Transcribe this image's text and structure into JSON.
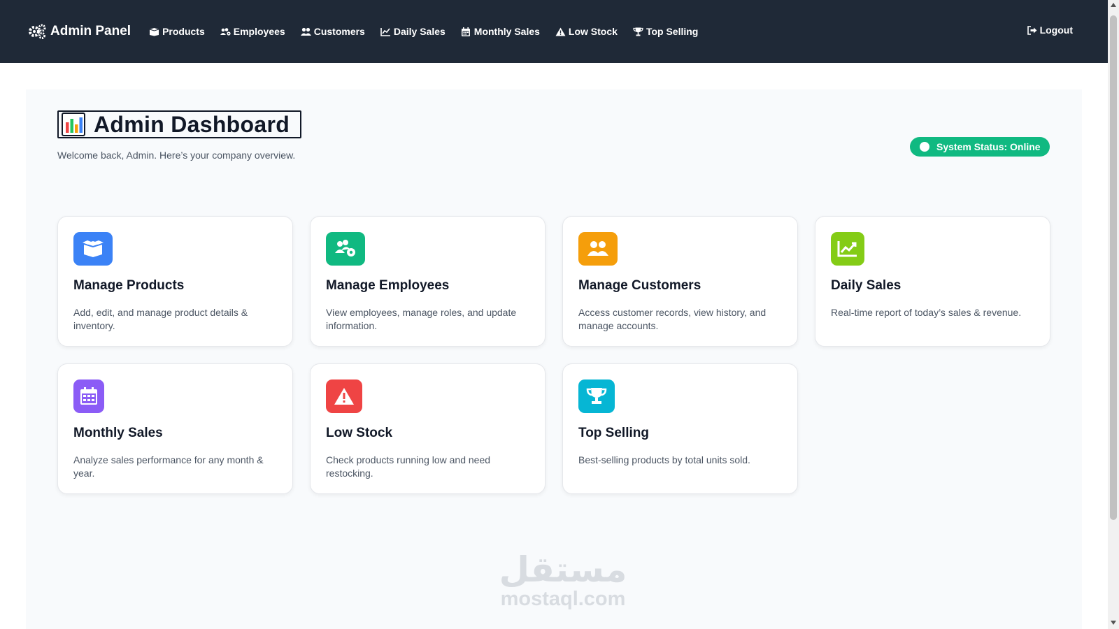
{
  "navbar": {
    "brand": "Admin Panel",
    "links": [
      {
        "label": "Products",
        "icon": "box-icon"
      },
      {
        "label": "Employees",
        "icon": "users-gear-icon"
      },
      {
        "label": "Customers",
        "icon": "users-icon"
      },
      {
        "label": "Daily Sales",
        "icon": "chart-line-icon"
      },
      {
        "label": "Monthly Sales",
        "icon": "calendar-icon"
      },
      {
        "label": "Low Stock",
        "icon": "warning-icon"
      },
      {
        "label": "Top Selling",
        "icon": "trophy-icon"
      }
    ],
    "logout": "Logout"
  },
  "header": {
    "title": "Admin Dashboard",
    "subtitle": "Welcome back, Admin. Here’s your company overview.",
    "status": "System Status: Online"
  },
  "cards": [
    {
      "title": "Manage Products",
      "desc": "Add, edit, and manage product details & inventory.",
      "icon": "box-open-icon",
      "color": "#3b82f6"
    },
    {
      "title": "Manage Employees",
      "desc": "View employees, manage roles, and update information.",
      "icon": "users-gear-icon",
      "color": "#10b981"
    },
    {
      "title": "Manage Customers",
      "desc": "Access customer records, view history, and manage accounts.",
      "icon": "users-icon",
      "color": "#f59e0b"
    },
    {
      "title": "Daily Sales",
      "desc": "Real-time report of today’s sales & revenue.",
      "icon": "chart-line-icon",
      "color": "#84cc16"
    },
    {
      "title": "Monthly Sales",
      "desc": "Analyze sales performance for any month & year.",
      "icon": "calendar-icon",
      "color": "#8b5cf6"
    },
    {
      "title": "Low Stock",
      "desc": "Check products running low and need restocking.",
      "icon": "warning-icon",
      "color": "#ef4444"
    },
    {
      "title": "Top Selling",
      "desc": "Best-selling products by total units sold.",
      "icon": "trophy-icon",
      "color": "#06b6d4"
    }
  ],
  "colors": {
    "navbar": "#1f2937",
    "status": "#10b981",
    "main_bg": "#f8fafc"
  },
  "watermark": {
    "arabic": "مستقل",
    "latin": "mostaql.com"
  }
}
